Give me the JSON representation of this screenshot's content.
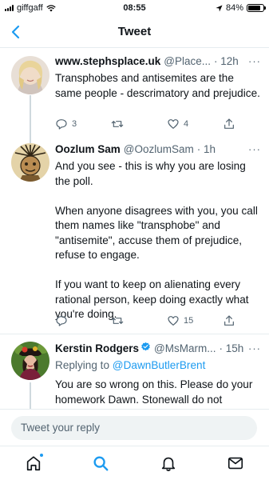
{
  "status_bar": {
    "carrier": "giffgaff",
    "time": "08:55",
    "battery": "84%",
    "battery_level": 0.84
  },
  "nav": {
    "title": "Tweet"
  },
  "tweets": [
    {
      "name": "www.stephsplace.uk",
      "handle": "@Place...",
      "time": "· 12h",
      "paragraphs": [
        "Transphobes and antisemites are the same people - descrimatory and prejudice."
      ],
      "replies": "3",
      "retweets": "",
      "likes": "4"
    },
    {
      "name": "Oozlum Sam",
      "handle": "@OozlumSam",
      "time": "· 1h",
      "paragraphs": [
        "And you see - this is why you are losing the poll.",
        "When anyone disagrees with you, you call them names like \"transphobe\" and \"antisemite\", accuse them of prejudice, refuse to engage.",
        "If you want to keep on alienating every rational person, keep doing exactly what you're doing."
      ],
      "replies": "",
      "retweets": "",
      "likes": "15"
    },
    {
      "name": "Kerstin Rodgers",
      "handle": "@MsMarm...",
      "time": "· 15h",
      "replying_prefix": "Replying to",
      "replying_to": "@DawnButlerBrent",
      "paragraphs": [
        "You are so wrong on this. Please do your homework Dawn. Stonewall do not support gay rights anymore. They aren't"
      ]
    }
  ],
  "more_label": "···",
  "reply_box": {
    "placeholder": "Tweet your reply"
  },
  "tabs": [
    "home-icon",
    "search-icon",
    "bell-icon",
    "mail-icon"
  ],
  "colors": {
    "accent": "#1d9bf0",
    "secondary_text": "#536471",
    "divider": "#e6ecf0"
  }
}
